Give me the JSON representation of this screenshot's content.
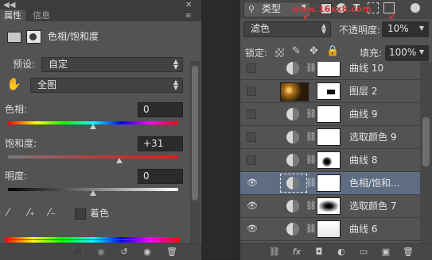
{
  "properties": {
    "tabs": [
      {
        "label": "属性"
      },
      {
        "label": "信息"
      }
    ],
    "title": "色相/饱和度",
    "preset_label": "预设:",
    "preset_value": "自定",
    "channel_value": "全图",
    "hue": {
      "label": "色相:",
      "value": "0",
      "level": 0.5
    },
    "saturation": {
      "label": "饱和度:",
      "value": "+31",
      "level": 0.655
    },
    "lightness": {
      "label": "明度:",
      "value": "0",
      "level": 0.5
    },
    "colorize_label": "着色"
  },
  "layers": {
    "filter_label": "类型",
    "blend_mode": "滤色",
    "opacity_label": "不透明度:",
    "opacity_value": "10%",
    "lock_label": "锁定:",
    "fill_label": "填充:",
    "fill_value": "100%",
    "watermark": "www.16xx8.com",
    "rows": [
      {
        "name": "曲线 10",
        "visible": false
      },
      {
        "name": "图层 2",
        "visible": false
      },
      {
        "name": "曲线 9",
        "visible": false
      },
      {
        "name": "选取颜色 9",
        "visible": false
      },
      {
        "name": "曲线 8",
        "visible": false
      },
      {
        "name": "色相/饱和...",
        "visible": true,
        "selected": true
      },
      {
        "name": "选取颜色 7",
        "visible": true
      },
      {
        "name": "曲线 6",
        "visible": true
      }
    ]
  }
}
